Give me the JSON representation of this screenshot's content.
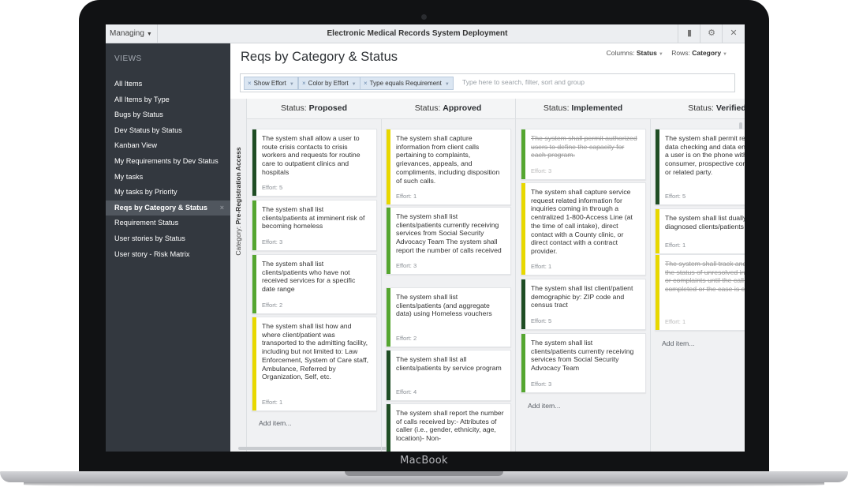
{
  "device_label": "MacBook",
  "app": {
    "title": "Electronic Medical Records System Deployment",
    "managing_label": "Managing"
  },
  "sidebar": {
    "heading": "VIEWS",
    "items": [
      {
        "label": "All Items"
      },
      {
        "label": "All Items by Type"
      },
      {
        "label": "Bugs by Status"
      },
      {
        "label": "Dev Status by Status"
      },
      {
        "label": "Kanban View"
      },
      {
        "label": "My Requirements by Dev Status"
      },
      {
        "label": "My tasks"
      },
      {
        "label": "My tasks by Priority"
      },
      {
        "label": "Reqs by Category & Status",
        "active": true
      },
      {
        "label": "Requirement Status"
      },
      {
        "label": "User stories by Status"
      },
      {
        "label": "User story - Risk Matrix"
      }
    ]
  },
  "main": {
    "title": "Reqs by Category & Status",
    "columns_label": "Columns:",
    "columns_value": "Status",
    "rows_label": "Rows:",
    "rows_value": "Category",
    "filters": [
      {
        "label": "Show Effort"
      },
      {
        "label": "Color by Effort"
      },
      {
        "label": "Type  equals  Requirement"
      }
    ],
    "filter_placeholder": "Type here to search, filter, sort and group",
    "row_label": "Category:",
    "row_value": "Pre-Registration Access",
    "add_item_label": "Add item...",
    "colors": {
      "dark_green": "#1f4d24",
      "green": "#55a630",
      "yellow": "#e8d800"
    },
    "columns": [
      {
        "prefix": "Status:",
        "name": "Proposed",
        "cards": [
          {
            "text": "The system shall allow a user to route crisis contacts to crisis workers and requests for routine care to outpatient clinics and hospitals",
            "effort": "Effort: 5",
            "color": "dark_green"
          },
          {
            "text": "The system shall list clients/patients at imminent risk of becoming homeless",
            "effort": "Effort: 3",
            "color": "green"
          },
          {
            "text": "The system shall list clients/patients who have not received services for a specific date range",
            "effort": "Effort: 2",
            "color": "green"
          },
          {
            "text": "The system shall list how and where client/patient was transported to the admitting facility, including but not limited to: Law Enforcement, System of Care staff, Ambulance, Referred by Organization, Self, etc.",
            "effort": "Effort: 1",
            "color": "yellow"
          }
        ]
      },
      {
        "prefix": "Status:",
        "name": "Approved",
        "cards": [
          {
            "text": "The system shall capture information from client calls pertaining to complaints, grievances, appeals, and compliments, including disposition of such calls.",
            "effort": "Effort: 1",
            "color": "yellow"
          },
          {
            "text": "The system shall list clients/patients currently receiving services from Social Security Advocacy Team The system shall report the number of calls received",
            "effort": "Effort: 3",
            "color": "green"
          },
          {
            "text": "The system shall list clients/patients (and aggregate data) using Homeless vouchers",
            "effort": "Effort: 2",
            "color": "green"
          },
          {
            "text": "The system shall list all clients/patients by service program",
            "effort": "Effort: 4",
            "color": "dark_green"
          },
          {
            "text": "The system shall report the number of calls received by:- Attributes of caller (i.e., gender, ethnicity, age, location)- Non-",
            "effort": "",
            "color": "dark_green"
          }
        ]
      },
      {
        "prefix": "Status:",
        "name": "Implemented",
        "cards": [
          {
            "text": "The system shall permit authorized users to define the capacity for each program.",
            "effort": "Effort: 3",
            "color": "green",
            "done": true
          },
          {
            "text": "The system shall capture service request related information for inquiries coming in through a centralized 1-800-Access Line (at the time of call intake), direct contact with a County clinic, or direct contact with a contract provider.",
            "effort": "Effort: 1",
            "color": "yellow"
          },
          {
            "text": "The system shall list client/patient demographic by: ZIP code and census tract",
            "effort": "Effort: 5",
            "color": "dark_green"
          },
          {
            "text": "The system shall list clients/patients currently receiving services from Social Security Advocacy Team",
            "effort": "Effort: 3",
            "color": "green"
          }
        ]
      },
      {
        "prefix": "Status:",
        "name": "Verified",
        "cards": [
          {
            "text": "The system shall permit real-time data checking and data entry while a user is on the phone with a consumer, prospective consumer, or related party.",
            "effort": "Effort: 5",
            "color": "dark_green"
          },
          {
            "text": "The system shall list dually diagnosed clients/patients",
            "effort": "Effort: 1",
            "color": "yellow"
          },
          {
            "text": "The system shall track and monitor the status of unresolved inquiries or complaints until the call is completed or the case is closed.",
            "effort": "Effort: 1",
            "color": "yellow",
            "done": true
          }
        ]
      }
    ]
  }
}
